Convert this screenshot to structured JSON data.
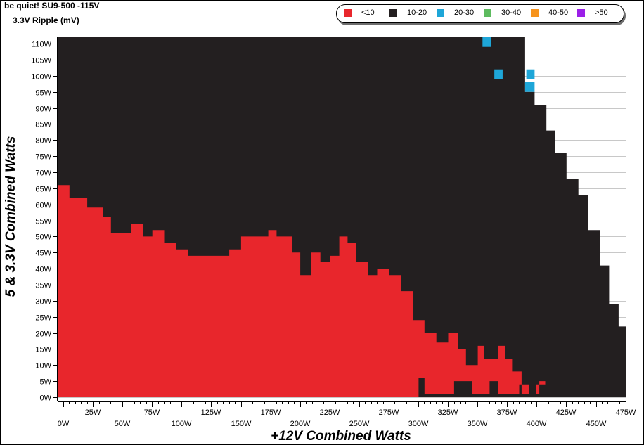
{
  "chart_data": {
    "type": "heatmap",
    "title": "be quiet! SU9-500 -115V",
    "subtitle": "3.3V Ripple (mV)",
    "xlabel": "+12V Combined Watts",
    "ylabel": "5 & 3.3V Combined Watts",
    "xlim": [
      0,
      480
    ],
    "ylim": [
      0,
      112
    ],
    "x_ticks": [
      "0W",
      "25W",
      "50W",
      "75W",
      "100W",
      "125W",
      "150W",
      "175W",
      "200W",
      "225W",
      "250W",
      "275W",
      "300W",
      "325W",
      "350W",
      "375W",
      "400W",
      "425W",
      "450W",
      "475W"
    ],
    "y_ticks": [
      "0W",
      "5W",
      "10W",
      "15W",
      "20W",
      "25W",
      "30W",
      "35W",
      "40W",
      "45W",
      "50W",
      "55W",
      "60W",
      "65W",
      "70W",
      "75W",
      "80W",
      "85W",
      "90W",
      "95W",
      "100W",
      "105W",
      "110W"
    ],
    "grid": true,
    "legend_position": "top-right",
    "legend": [
      {
        "label": "<10",
        "color": "#e8262c"
      },
      {
        "label": "10-20",
        "color": "#231f20"
      },
      {
        "label": "20-30",
        "color": "#1ea6d8"
      },
      {
        "label": "30-40",
        "color": "#5dbb5f"
      },
      {
        "label": "40-50",
        "color": "#f7941d"
      },
      {
        "label": ">50",
        "color": "#9b1fe8"
      }
    ],
    "max_load_boundary": [
      [
        0,
        112
      ],
      [
        395,
        112
      ],
      [
        395,
        95
      ],
      [
        403,
        95
      ],
      [
        403,
        91
      ],
      [
        413,
        91
      ],
      [
        413,
        83
      ],
      [
        420,
        83
      ],
      [
        420,
        76
      ],
      [
        430,
        76
      ],
      [
        430,
        68
      ],
      [
        440,
        68
      ],
      [
        440,
        63
      ],
      [
        448,
        63
      ],
      [
        448,
        52
      ],
      [
        458,
        52
      ],
      [
        458,
        41
      ],
      [
        466,
        41
      ],
      [
        466,
        29
      ],
      [
        474,
        29
      ],
      [
        474,
        22
      ],
      [
        484,
        22
      ],
      [
        484,
        0
      ],
      [
        0,
        0
      ]
    ],
    "region_under_10mV": [
      [
        0,
        0
      ],
      [
        305,
        0
      ],
      [
        305,
        6
      ],
      [
        310,
        6
      ],
      [
        310,
        1
      ],
      [
        335,
        1
      ],
      [
        335,
        5
      ],
      [
        350,
        5
      ],
      [
        350,
        1
      ],
      [
        365,
        1
      ],
      [
        365,
        5
      ],
      [
        372,
        5
      ],
      [
        372,
        1
      ],
      [
        390,
        1
      ],
      [
        390,
        4
      ],
      [
        398,
        4
      ],
      [
        398,
        1
      ],
      [
        407,
        1
      ],
      [
        407,
        5
      ],
      [
        412,
        5
      ],
      [
        412,
        4
      ],
      [
        404,
        4
      ],
      [
        404,
        1
      ],
      [
        392,
        1
      ],
      [
        392,
        8
      ],
      [
        384,
        8
      ],
      [
        384,
        12
      ],
      [
        378,
        12
      ],
      [
        378,
        16
      ],
      [
        372,
        16
      ],
      [
        372,
        12
      ],
      [
        360,
        12
      ],
      [
        360,
        16
      ],
      [
        355,
        16
      ],
      [
        355,
        10
      ],
      [
        345,
        10
      ],
      [
        345,
        15
      ],
      [
        338,
        15
      ],
      [
        338,
        20
      ],
      [
        330,
        20
      ],
      [
        330,
        17
      ],
      [
        320,
        17
      ],
      [
        320,
        20
      ],
      [
        310,
        20
      ],
      [
        310,
        24
      ],
      [
        300,
        24
      ],
      [
        300,
        33
      ],
      [
        290,
        33
      ],
      [
        290,
        38
      ],
      [
        280,
        38
      ],
      [
        280,
        40
      ],
      [
        270,
        40
      ],
      [
        270,
        38
      ],
      [
        262,
        38
      ],
      [
        262,
        42
      ],
      [
        252,
        42
      ],
      [
        252,
        48
      ],
      [
        245,
        48
      ],
      [
        245,
        50
      ],
      [
        238,
        50
      ],
      [
        238,
        44
      ],
      [
        230,
        44
      ],
      [
        230,
        42
      ],
      [
        222,
        42
      ],
      [
        222,
        45
      ],
      [
        214,
        45
      ],
      [
        214,
        38
      ],
      [
        205,
        38
      ],
      [
        205,
        45
      ],
      [
        198,
        45
      ],
      [
        198,
        50
      ],
      [
        185,
        50
      ],
      [
        185,
        52
      ],
      [
        178,
        52
      ],
      [
        178,
        50
      ],
      [
        155,
        50
      ],
      [
        155,
        46
      ],
      [
        145,
        46
      ],
      [
        145,
        44
      ],
      [
        110,
        44
      ],
      [
        110,
        46
      ],
      [
        100,
        46
      ],
      [
        100,
        48
      ],
      [
        90,
        48
      ],
      [
        90,
        52
      ],
      [
        80,
        52
      ],
      [
        80,
        50
      ],
      [
        72,
        50
      ],
      [
        72,
        54
      ],
      [
        62,
        54
      ],
      [
        62,
        51
      ],
      [
        45,
        51
      ],
      [
        45,
        56
      ],
      [
        38,
        56
      ],
      [
        38,
        59
      ],
      [
        25,
        59
      ],
      [
        25,
        62
      ],
      [
        10,
        62
      ],
      [
        10,
        66
      ],
      [
        0,
        66
      ]
    ],
    "region_20_30mV": [
      {
        "x": 359,
        "y": 109,
        "w": 7,
        "h": 3
      },
      {
        "x": 369,
        "y": 99,
        "w": 7,
        "h": 3
      },
      {
        "x": 396,
        "y": 99,
        "w": 7,
        "h": 3
      },
      {
        "x": 395,
        "y": 95,
        "w": 8,
        "h": 3
      }
    ]
  }
}
